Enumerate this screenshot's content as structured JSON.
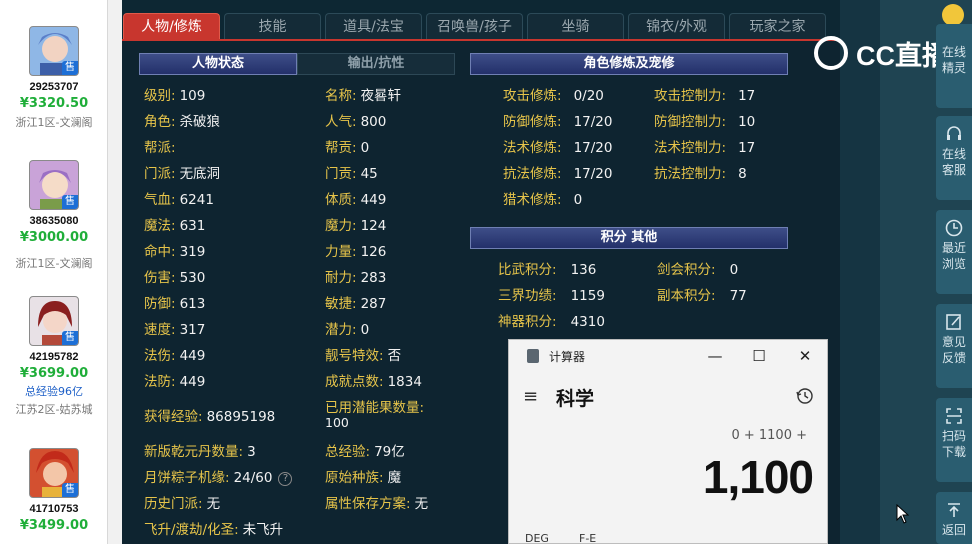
{
  "left_listings": [
    {
      "id": "29253707",
      "price": "¥3320.50",
      "note": "",
      "server": "浙江1区-文澜阁",
      "tag": "售",
      "avatar_color": "#8fb7e6"
    },
    {
      "id": "38635080",
      "price": "¥3000.00",
      "note": "",
      "server": "浙江1区-文澜阁",
      "tag": "售",
      "avatar_color": "#c9a3d8"
    },
    {
      "id": "42195782",
      "price": "¥3699.00",
      "note": "总经验96亿",
      "server": "江苏2区-姑苏城",
      "tag": "售",
      "avatar_color": "#b3493a"
    },
    {
      "id": "41710753",
      "price": "¥3499.00",
      "note": "",
      "server": "",
      "tag": "售",
      "avatar_color": "#d35030"
    }
  ],
  "tabs": [
    {
      "label": "人物/修炼",
      "active": true
    },
    {
      "label": "技能",
      "active": false
    },
    {
      "label": "道具/法宝",
      "active": false
    },
    {
      "label": "召唤兽/孩子",
      "active": false
    },
    {
      "label": "坐骑",
      "active": false
    },
    {
      "label": "锦衣/外观",
      "active": false
    },
    {
      "label": "玩家之家",
      "active": false
    }
  ],
  "sections": {
    "status": "人物状态",
    "resist": "输出/抗性",
    "cultivation": "角色修炼及宠修",
    "points": "积分 其他"
  },
  "stats": {
    "level": {
      "k": "级别:",
      "v": "109"
    },
    "name": {
      "k": "名称:",
      "v": "夜晷轩"
    },
    "role": {
      "k": "角色:",
      "v": "杀破狼"
    },
    "popularity": {
      "k": "人气:",
      "v": "800"
    },
    "guild": {
      "k": "帮派:",
      "v": ""
    },
    "guild_contrib": {
      "k": "帮贡:",
      "v": "0"
    },
    "school": {
      "k": "门派:",
      "v": "无底洞"
    },
    "school_contrib": {
      "k": "门贡:",
      "v": "45"
    },
    "hp": {
      "k": "气血:",
      "v": "6241"
    },
    "constitution": {
      "k": "体质:",
      "v": "449"
    },
    "mp": {
      "k": "魔法:",
      "v": "631"
    },
    "magic_power": {
      "k": "魔力:",
      "v": "124"
    },
    "hit": {
      "k": "命中:",
      "v": "319"
    },
    "strength": {
      "k": "力量:",
      "v": "126"
    },
    "damage": {
      "k": "伤害:",
      "v": "530"
    },
    "endurance": {
      "k": "耐力:",
      "v": "283"
    },
    "defense": {
      "k": "防御:",
      "v": "613"
    },
    "agility": {
      "k": "敏捷:",
      "v": "287"
    },
    "speed": {
      "k": "速度:",
      "v": "317"
    },
    "potential": {
      "k": "潜力:",
      "v": "0"
    },
    "magic_dmg": {
      "k": "法伤:",
      "v": "449"
    },
    "pretty_id": {
      "k": "靓号特效:",
      "v": "否"
    },
    "magic_def": {
      "k": "法防:",
      "v": "449"
    },
    "achievement": {
      "k": "成就点数:",
      "v": "1834"
    },
    "exp_gained": {
      "k": "获得经验:",
      "v": "86895198"
    },
    "energy_used": {
      "k": "已用潜能果数量:",
      "v": "100"
    },
    "qianyuan": {
      "k": "新版乾元丹数量:",
      "v": "3"
    },
    "total_exp": {
      "k": "总经验:",
      "v": "79亿"
    },
    "mooncake": {
      "k": "月饼粽子机缘:",
      "v": "24/60"
    },
    "origin_race": {
      "k": "原始种族:",
      "v": "魔"
    },
    "history_school": {
      "k": "历史门派:",
      "v": "无"
    },
    "attr_plan": {
      "k": "属性保存方案:",
      "v": "无"
    },
    "ascension": {
      "k": "飞升/渡劫/化圣:",
      "v": "未飞升"
    }
  },
  "cultivation": {
    "atk": {
      "k": "攻击修炼:",
      "v": "0/20"
    },
    "atk_ctrl": {
      "k": "攻击控制力:",
      "v": "17"
    },
    "def": {
      "k": "防御修炼:",
      "v": "17/20"
    },
    "def_ctrl": {
      "k": "防御控制力:",
      "v": "10"
    },
    "mag": {
      "k": "法术修炼:",
      "v": "17/20"
    },
    "mag_ctrl": {
      "k": "法术控制力:",
      "v": "17"
    },
    "res": {
      "k": "抗法修炼:",
      "v": "17/20"
    },
    "res_ctrl": {
      "k": "抗法控制力:",
      "v": "8"
    },
    "hunt": {
      "k": "猎术修炼:",
      "v": "0"
    }
  },
  "points": {
    "duel": {
      "k": "比武积分:",
      "v": "136"
    },
    "sword": {
      "k": "剑会积分:",
      "v": "0"
    },
    "realm": {
      "k": "三界功绩:",
      "v": "1159"
    },
    "dungeon": {
      "k": "副本积分:",
      "v": "77"
    },
    "artifact": {
      "k": "神器积分:",
      "v": "4310"
    }
  },
  "cc_logo": "CC直播",
  "side_buttons": [
    {
      "label1": "在线",
      "label2": "精灵",
      "icon": "sprite-icon"
    },
    {
      "label1": "在线",
      "label2": "客服",
      "icon": "headset-icon"
    },
    {
      "label1": "最近",
      "label2": "浏览",
      "icon": "clock-icon"
    },
    {
      "label1": "意见",
      "label2": "反馈",
      "icon": "edit-icon"
    },
    {
      "label1": "扫码",
      "label2": "下载",
      "icon": "scan-icon"
    },
    {
      "label1": "返回",
      "label2": "",
      "icon": "top-arrow-icon"
    }
  ],
  "calculator": {
    "title": "计算器",
    "mode": "科学",
    "expression": "0 + 1100 +",
    "display": "1,100",
    "deg": "DEG",
    "fe": "F-E",
    "menu_glyph": "≡",
    "minimize_glyph": "—",
    "maximize_glyph": "☐",
    "close_glyph": "✕"
  }
}
